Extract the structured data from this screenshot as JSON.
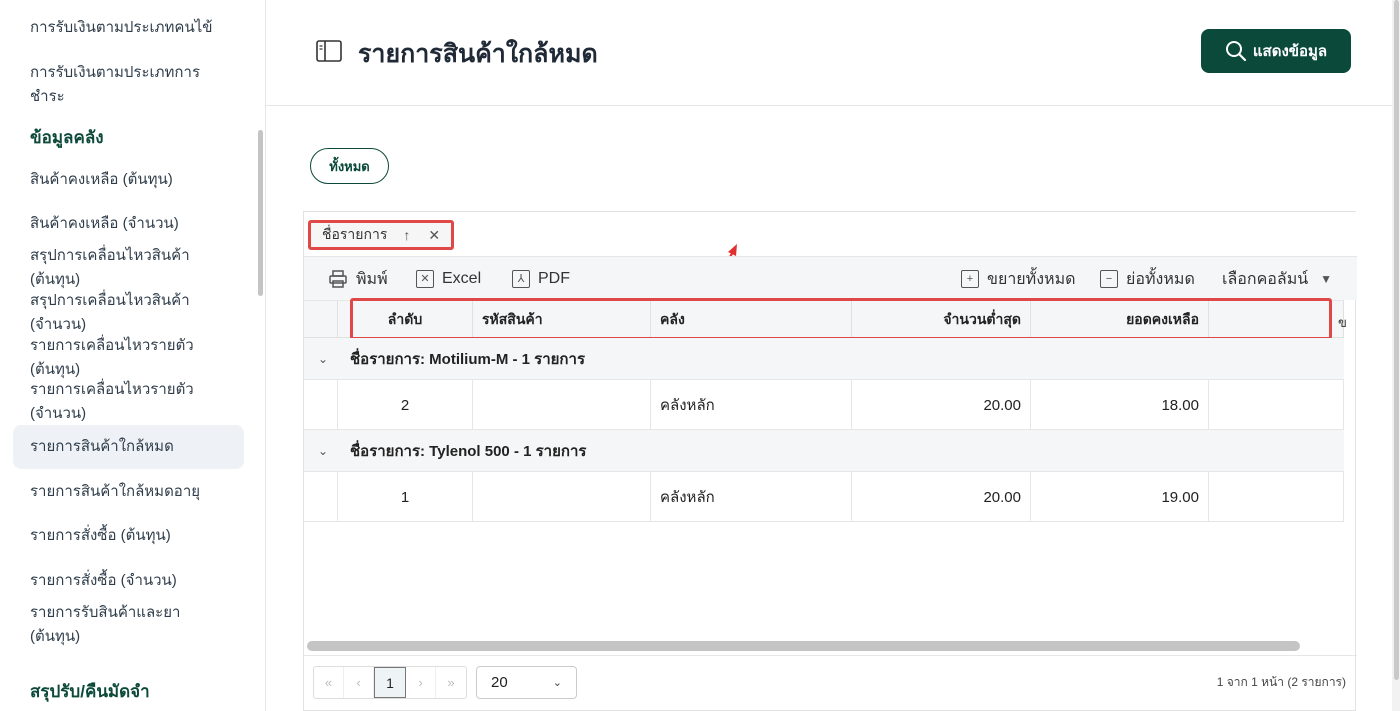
{
  "sidebar": {
    "items_top": [
      {
        "label": "การรับเงินตามประเภทคนไข้"
      },
      {
        "label": "การรับเงินตามประเภทการชำระ"
      }
    ],
    "section_inventory": "ข้อมูลคลัง",
    "items": [
      {
        "label": "สินค้าคงเหลือ (ต้นทุน)"
      },
      {
        "label": "สินค้าคงเหลือ (จำนวน)"
      },
      {
        "label": "สรุปการเคลื่อนไหวสินค้า (ต้นทุน)"
      },
      {
        "label": "สรุปการเคลื่อนไหวสินค้า (จำนวน)"
      },
      {
        "label": "รายการเคลื่อนไหวรายตัว (ต้นทุน)"
      },
      {
        "label": "รายการเคลื่อนไหวรายตัว (จำนวน)"
      },
      {
        "label": "รายการสินค้าใกล้หมด"
      },
      {
        "label": "รายการสินค้าใกล้หมดอายุ"
      },
      {
        "label": "รายการสั่งซื้อ (ต้นทุน)"
      },
      {
        "label": "รายการสั่งซื้อ (จำนวน)"
      },
      {
        "label": "รายการรับสินค้าและยา (ต้นทุน)"
      }
    ],
    "section_deposit": "สรุปรับ/คืนมัดจำ"
  },
  "header": {
    "title": "รายการสินค้าใกล้หมด",
    "show_button": "แสดงข้อมูล"
  },
  "filter": {
    "all_label": "ทั้งหมด"
  },
  "grid": {
    "group_chip": "ชื่อรายการ",
    "toolbar": {
      "print": "พิมพ์",
      "excel": "Excel",
      "pdf": "PDF",
      "expand_all": "ขยายทั้งหมด",
      "collapse_all": "ย่อทั้งหมด",
      "choose_columns": "เลือกคอลัมน์"
    },
    "columns": [
      "ลำดับ",
      "รหัสสินค้า",
      "คลัง",
      "จำนวนต่ำสุด",
      "ยอดคงเหลือ"
    ],
    "overflow_glyph": "ข",
    "groups": [
      {
        "label": "ชื่อรายการ: Motilium-M - 1 รายการ",
        "rows": [
          {
            "order": "2",
            "code": "",
            "warehouse": "คลังหลัก",
            "min_qty": "20.00",
            "balance": "18.00"
          }
        ]
      },
      {
        "label": "ชื่อรายการ: Tylenol 500 - 1 รายการ",
        "rows": [
          {
            "order": "1",
            "code": "",
            "warehouse": "คลังหลัก",
            "min_qty": "20.00",
            "balance": "19.00"
          }
        ]
      }
    ],
    "pager": {
      "first": "«",
      "prev": "‹",
      "current": "1",
      "next": "›",
      "last": "»",
      "page_size": "20",
      "info": "1 จาก 1 หน้า (2 รายการ)"
    }
  },
  "colors": {
    "brand": "#0b4a3a",
    "highlight": "#e04848"
  }
}
